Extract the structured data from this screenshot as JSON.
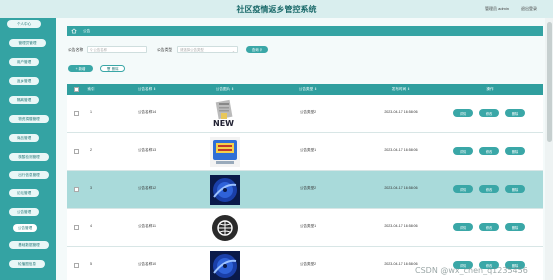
{
  "header": {
    "title": "社区疫情返乡管控系统",
    "admin_label": "管理员 admin",
    "logout": "退出登录"
  },
  "sidebar": {
    "items": [
      {
        "label": "个人中心"
      },
      {
        "label": "管理员管理"
      },
      {
        "label": "用户管理"
      },
      {
        "label": "返乡管理"
      },
      {
        "label": "隔离管理"
      },
      {
        "label": "物资捐赠管理"
      },
      {
        "label": "商品管理"
      },
      {
        "label": "核酸检测管理"
      },
      {
        "label": "出行信息管理"
      },
      {
        "label": "论坛管理"
      },
      {
        "label": "公告管理"
      },
      {
        "label": "公告管理"
      },
      {
        "label": "基础数据管理"
      },
      {
        "label": "轮播图信息"
      }
    ]
  },
  "breadcrumb": {
    "label": "公告"
  },
  "search": {
    "name_label": "公告名称",
    "name_placeholder": "公告名称",
    "type_label": "公告类型",
    "type_placeholder": "请选择公告类型",
    "button": "查询"
  },
  "actions": {
    "add": "新增",
    "delete": "删除"
  },
  "table": {
    "columns": [
      "索引",
      "公告名称",
      "公告图片",
      "公告类型",
      "发布时间",
      "操作"
    ],
    "op_buttons": [
      "详情",
      "修改",
      "删除"
    ],
    "rows": [
      {
        "index": "1",
        "name": "公告名称14",
        "image": "news-image",
        "type": "公告类型2",
        "time": "2023-04-17 16:58:06"
      },
      {
        "index": "2",
        "name": "公告名称13",
        "image": "report-card-image",
        "type": "公告类型1",
        "time": "2023-04-17 16:58:06"
      },
      {
        "index": "3",
        "name": "公告名称12",
        "image": "blue-disc-image",
        "type": "公告类型2",
        "time": "2023-04-17 16:58:06"
      },
      {
        "index": "4",
        "name": "公告名称11",
        "image": "globe-badge-image",
        "type": "公告类型1",
        "time": "2023-04-17 16:58:06"
      },
      {
        "index": "5",
        "name": "公告名称10",
        "image": "blue-disc-image",
        "type": "公告类型2",
        "time": "2023-04-17 16:58:06"
      }
    ]
  },
  "watermark": "CSDN @wx_chen_q1235456",
  "colors": {
    "primary": "#34a3a3",
    "header_bg": "#d9eeee",
    "selected_row": "#a9dada"
  }
}
